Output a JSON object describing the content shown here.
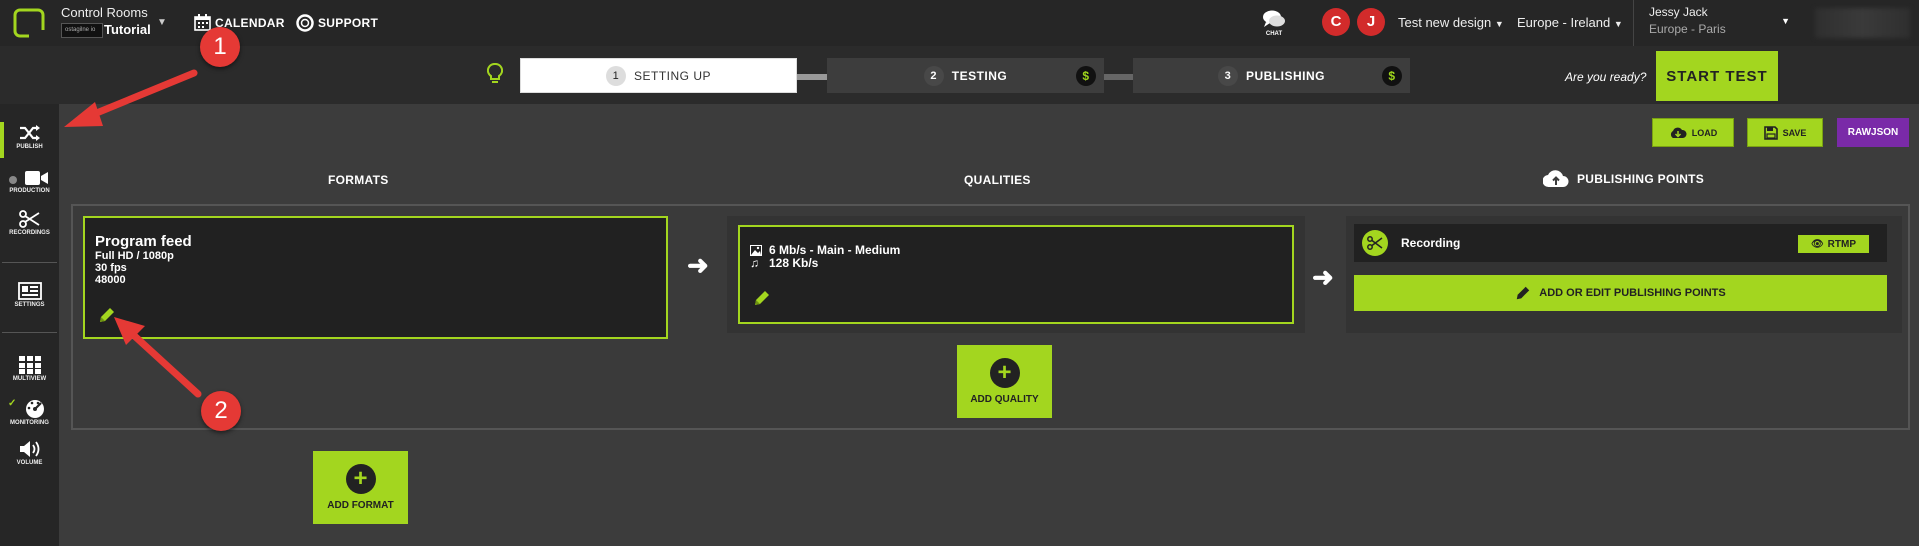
{
  "topbar": {
    "app_title": "Control Rooms",
    "app_small_label": "ostagilne io",
    "room_name": "Tutorial",
    "calendar_label": "CALENDAR",
    "support_label": "SUPPORT",
    "chat_label": "CHAT",
    "avatars": [
      "C",
      "J"
    ],
    "design_label": "Test new design",
    "region_label": "Europe - Ireland",
    "user_name": "Jessy Jack",
    "user_region": "Europe - Paris"
  },
  "steps": [
    {
      "num": "1",
      "label": "SETTING UP",
      "active": true
    },
    {
      "num": "2",
      "label": "TESTING",
      "active": false
    },
    {
      "num": "3",
      "label": "PUBLISHING",
      "active": false
    }
  ],
  "ready_text": "Are you ready?",
  "start_test_label": "START TEST",
  "sidebar": {
    "publish": "PUBLISH",
    "production": "PRODUCTION",
    "recordings": "RECORDINGS",
    "settings": "SETTINGS",
    "multiview": "MULTIVIEW",
    "monitoring": "MONITORING",
    "volume": "VOLUME"
  },
  "toolbar": {
    "load": "LOAD",
    "save": "SAVE",
    "rawjson": "RAWJSON"
  },
  "columns": {
    "formats": "FORMATS",
    "qualities": "QUALITIES",
    "publishing": "PUBLISHING POINTS"
  },
  "format": {
    "title": "Program feed",
    "lines": [
      "Full HD / 1080p",
      "30 fps",
      "48000"
    ]
  },
  "quality": {
    "video": "6 Mb/s  -  Main  -  Medium",
    "audio": "128 Kb/s"
  },
  "publishing": {
    "recording": "Recording",
    "rtmp": "RTMP",
    "add_edit": "ADD OR EDIT PUBLISHING POINTS"
  },
  "add_quality_label": "ADD QUALITY",
  "add_format_label": "ADD FORMAT",
  "annotations": [
    "1",
    "2"
  ],
  "colors": {
    "accent": "#a3d61f",
    "badge": "#e53935",
    "rawjson": "#7a2aa8",
    "avatar": "#d22b2b"
  }
}
